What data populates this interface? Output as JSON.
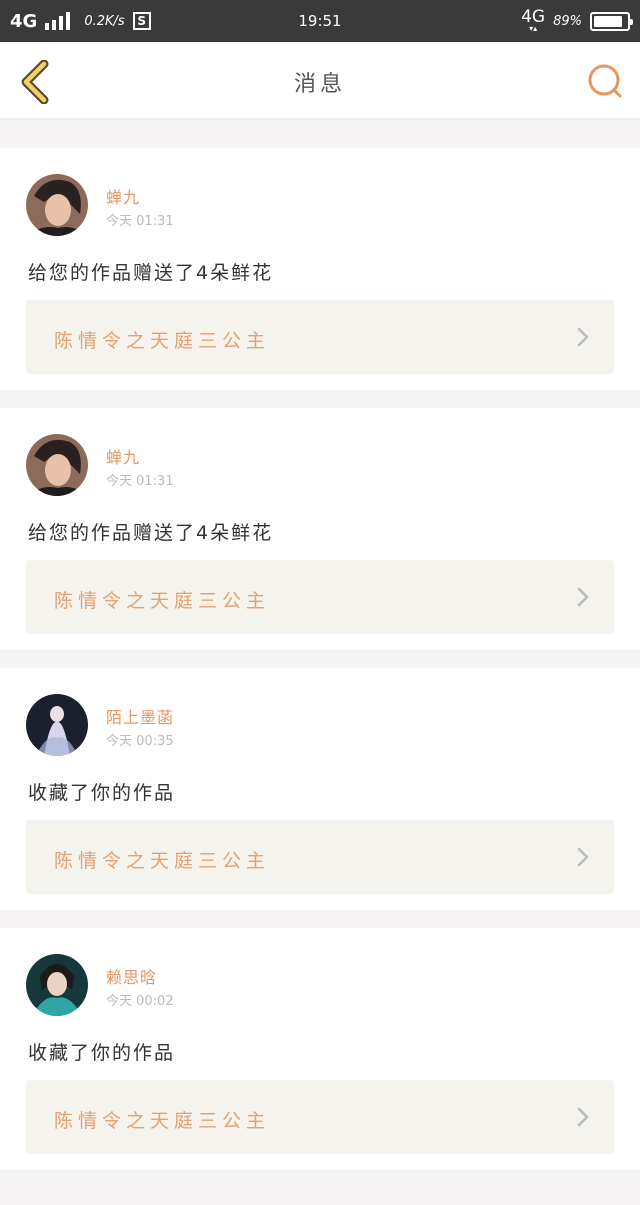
{
  "status_bar": {
    "network": "4G",
    "speed": "0.2K/s",
    "s_badge": "S",
    "time": "19:51",
    "network_right": "4G",
    "battery": "89%",
    "battery_level": 0.89
  },
  "nav": {
    "title": "消息",
    "back_icon": "chevron-left-icon",
    "search_icon": "search-icon",
    "accent": "#e6965f"
  },
  "messages": [
    {
      "name": "蝉九",
      "time": "今天 01:31",
      "text": "给您的作品赠送了4朵鲜花",
      "work": "陈情令之天庭三公主"
    },
    {
      "name": "蝉九",
      "time": "今天 01:31",
      "text": "给您的作品赠送了4朵鲜花",
      "work": "陈情令之天庭三公主"
    },
    {
      "name": "陌上墨菡",
      "time": "今天 00:35",
      "text": "收藏了你的作品",
      "work": "陈情令之天庭三公主"
    },
    {
      "name": "赖思晗",
      "time": "今天 00:02",
      "text": "收藏了你的作品",
      "work": "陈情令之天庭三公主"
    }
  ]
}
